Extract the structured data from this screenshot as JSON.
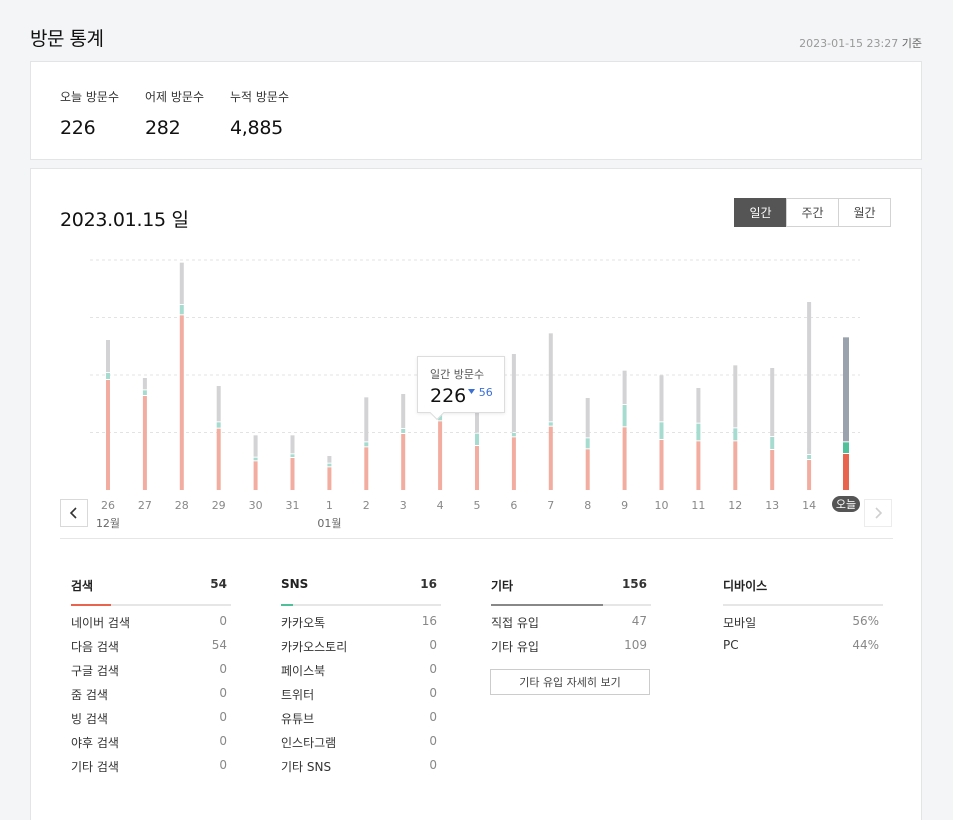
{
  "header": {
    "title": "방문 통계",
    "updated_at": "2023-01-15 23:27",
    "updated_suffix": "기준"
  },
  "summary": [
    {
      "label": "오늘 방문수",
      "value": "226"
    },
    {
      "label": "어제 방문수",
      "value": "282"
    },
    {
      "label": "누적 방문수",
      "value": "4,885"
    }
  ],
  "chart_header": {
    "date": "2023.01.15 일",
    "tabs": [
      {
        "label": "일간",
        "active": true
      },
      {
        "label": "주간",
        "active": false
      },
      {
        "label": "월간",
        "active": false
      }
    ]
  },
  "tooltip": {
    "label": "일간 방문수",
    "value": "226",
    "diff": "56",
    "diff_direction": "down"
  },
  "colors": {
    "search": "#f2ada0",
    "sns": "#a6dccf",
    "other": "#d3d3d6",
    "today_search": "#e8644c",
    "today_sns": "#4fc09a",
    "today_other": "#99a2ad",
    "today_pill": "#555555",
    "search_accent": "#e8644c",
    "sns_accent": "#4fc09a",
    "other_accent": "#888888"
  },
  "chart_data": {
    "type": "bar",
    "stacked": true,
    "categories": [
      "26",
      "27",
      "28",
      "29",
      "30",
      "31",
      "1",
      "2",
      "3",
      "4",
      "5",
      "6",
      "7",
      "8",
      "9",
      "10",
      "11",
      "12",
      "13",
      "14",
      "오늘"
    ],
    "month_labels": [
      {
        "index": 0,
        "label": "12월"
      },
      {
        "index": 6,
        "label": "01월"
      }
    ],
    "highlight_index": 20,
    "grid": true,
    "series": [
      {
        "key": "search",
        "values": [
          165,
          141,
          262,
          92,
          43,
          48,
          34,
          64,
          84,
          103,
          66,
          79,
          95,
          61,
          94,
          75,
          73,
          73,
          60,
          45,
          54
        ]
      },
      {
        "key": "sns",
        "values": [
          9,
          7,
          14,
          8,
          4,
          4,
          4,
          6,
          6,
          25,
          17,
          5,
          5,
          15,
          32,
          25,
          25,
          18,
          18,
          6,
          16
        ]
      },
      {
        "key": "other",
        "values": [
          48,
          17,
          62,
          53,
          32,
          27,
          10,
          66,
          51,
          37,
          61,
          117,
          132,
          59,
          50,
          69,
          52,
          93,
          102,
          228,
          156
        ]
      }
    ],
    "ylim": [
      0,
      390
    ]
  },
  "stats": {
    "search": {
      "title": "검색",
      "total": "54",
      "rows": [
        {
          "label": "네이버 검색",
          "value": "0"
        },
        {
          "label": "다음 검색",
          "value": "54"
        },
        {
          "label": "구글 검색",
          "value": "0"
        },
        {
          "label": "줌 검색",
          "value": "0"
        },
        {
          "label": "빙 검색",
          "value": "0"
        },
        {
          "label": "야후 검색",
          "value": "0"
        },
        {
          "label": "기타 검색",
          "value": "0"
        }
      ]
    },
    "sns": {
      "title": "SNS",
      "total": "16",
      "rows": [
        {
          "label": "카카오톡",
          "value": "16"
        },
        {
          "label": "카카오스토리",
          "value": "0"
        },
        {
          "label": "페이스북",
          "value": "0"
        },
        {
          "label": "트위터",
          "value": "0"
        },
        {
          "label": "유튜브",
          "value": "0"
        },
        {
          "label": "인스타그램",
          "value": "0"
        },
        {
          "label": "기타 SNS",
          "value": "0"
        }
      ]
    },
    "other": {
      "title": "기타",
      "total": "156",
      "rows": [
        {
          "label": "직접 유입",
          "value": "47"
        },
        {
          "label": "기타 유입",
          "value": "109"
        }
      ],
      "detail_button": "기타 유입 자세히 보기"
    },
    "device": {
      "title": "디바이스",
      "rows": [
        {
          "label": "모바일",
          "value": "56%"
        },
        {
          "label": "PC",
          "value": "44%"
        }
      ]
    }
  }
}
